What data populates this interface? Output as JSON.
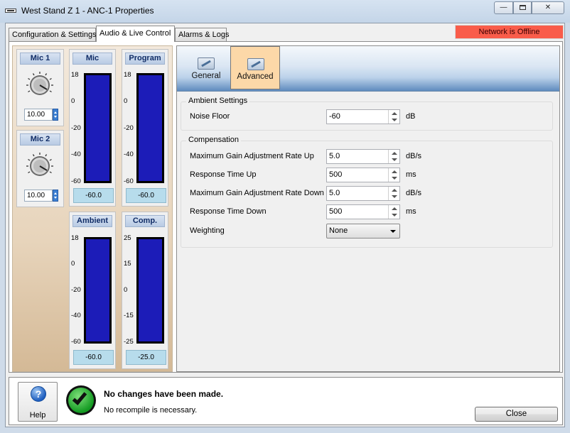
{
  "window": {
    "title": "West Stand Z 1 - ANC-1 Properties",
    "minimize": "—",
    "close": "✕"
  },
  "tabs": [
    {
      "label": "Configuration & Settings"
    },
    {
      "label": "Audio & Live Control"
    },
    {
      "label": "Alarms & Logs"
    }
  ],
  "network_status": "Network is Offline",
  "mics": [
    {
      "title": "Mic 1",
      "value": "10.00"
    },
    {
      "title": "Mic 2",
      "value": "10.00"
    }
  ],
  "meters": {
    "mic": {
      "title": "Mic",
      "scale": [
        "18",
        "0",
        "-20",
        "-40",
        "-60"
      ],
      "value": "-60.0",
      "level": 0
    },
    "program": {
      "title": "Program",
      "scale": [
        "18",
        "0",
        "-20",
        "-40",
        "-60"
      ],
      "value": "-60.0",
      "level": 0
    },
    "ambient": {
      "title": "Ambient",
      "scale": [
        "18",
        "0",
        "-20",
        "-40",
        "-60"
      ],
      "value": "-60.0",
      "level": 0
    },
    "comp": {
      "title": "Comp.",
      "scale": [
        "25",
        "15",
        "0",
        "-15",
        "-25"
      ],
      "value": "-25.0",
      "level": 0
    }
  },
  "ribbon": {
    "general": "General",
    "advanced": "Advanced"
  },
  "ambient_settings": {
    "title": "Ambient Settings",
    "noise_floor": {
      "label": "Noise Floor",
      "value": "-60",
      "unit": "dB"
    }
  },
  "compensation": {
    "title": "Compensation",
    "rows": [
      {
        "label": "Maximum Gain Adjustment Rate Up",
        "value": "5.0",
        "unit": "dB/s"
      },
      {
        "label": "Response Time Up",
        "value": "500",
        "unit": "ms"
      },
      {
        "label": "Maximum Gain Adjustment Rate Down",
        "value": "5.0",
        "unit": "dB/s"
      },
      {
        "label": "Response Time Down",
        "value": "500",
        "unit": "ms"
      }
    ],
    "weighting": {
      "label": "Weighting",
      "value": "None"
    }
  },
  "footer": {
    "help": "Help",
    "status_title": "No changes have been made.",
    "status_sub": "No recompile is necessary.",
    "close": "Close"
  }
}
